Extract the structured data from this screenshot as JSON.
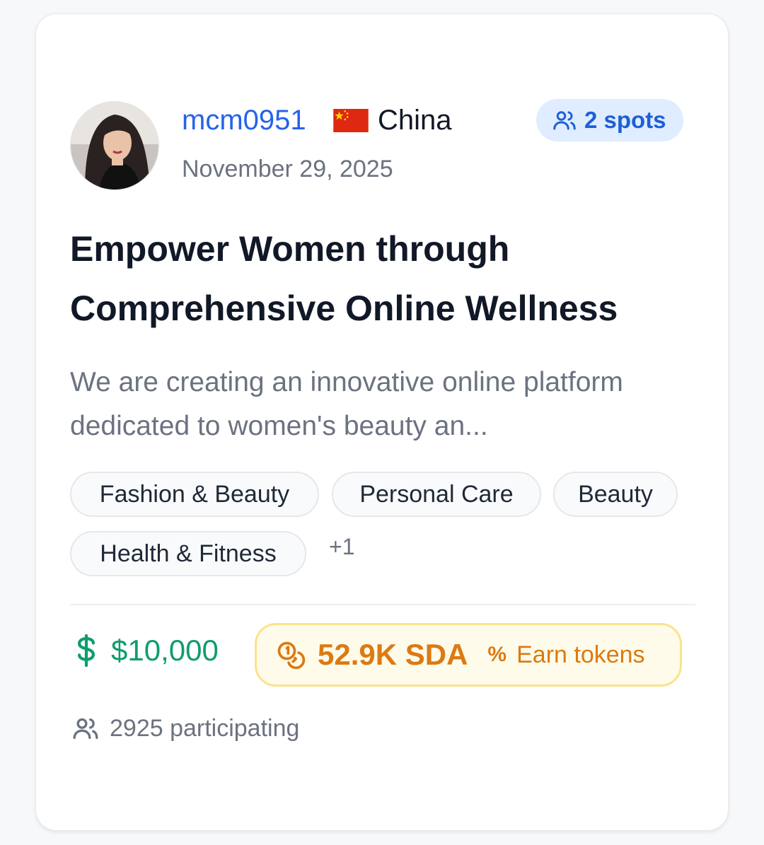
{
  "user": {
    "username": "mcm0951",
    "country": "China",
    "date": "November 29, 2025"
  },
  "spots": {
    "label": "2 spots",
    "icon": "users-icon"
  },
  "title": "Empower Women through Comprehensive Online Wellness",
  "description": "We are creating an innovative online platform dedicated to women's beauty an...",
  "tags": [
    "Fashion & Beauty",
    "Personal Care",
    "Beauty",
    "Health & Fitness"
  ],
  "more_tags": "+1",
  "reward": {
    "icon": "dollar-icon",
    "amount": "$10,000"
  },
  "token": {
    "icon": "coins-icon",
    "amount": "52.9K SDA",
    "percent_symbol": "%",
    "earn_label": "Earn tokens"
  },
  "participants": {
    "icon": "users-icon",
    "label": "2925 participating"
  },
  "colors": {
    "link": "#2563eb",
    "spots_bg": "#e0ecff",
    "reward_green": "#0f9d6b",
    "token_orange": "#dc7a12",
    "token_bg": "#fefbea",
    "token_border": "#fbe38a"
  }
}
